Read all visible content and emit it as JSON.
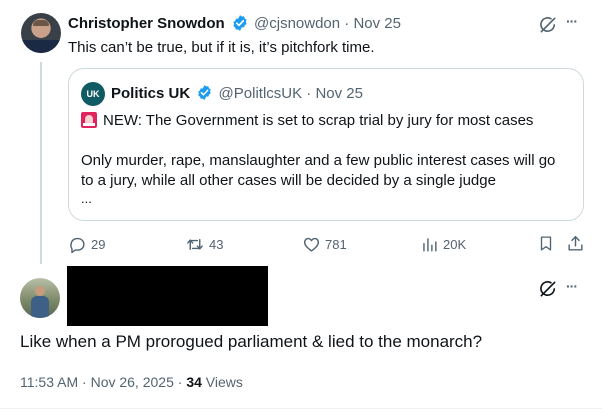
{
  "parent_tweet": {
    "author_name": "Christopher Snowdon",
    "handle": "@cjsnowdon",
    "separator": "·",
    "date": "Nov 25",
    "text": "This can’t be true, but if it is, it’s pitchfork time.",
    "more_label": "···"
  },
  "quote_tweet": {
    "avatar_text": "UK",
    "author_name": "Politics UK",
    "handle": "@PolitlcsUK",
    "separator": "·",
    "date": "Nov 25",
    "siren_emoji": "🚨",
    "headline": "NEW: The Government is set to scrap trial by jury for most cases",
    "body_line1": "Only murder, rape, manslaughter and a few public interest cases will go",
    "body_line2": "to a jury, while all other cases will be decided by a single judge",
    "ellipsis": "..."
  },
  "actions": {
    "replies": "29",
    "retweets": "43",
    "likes": "781",
    "views": "20K"
  },
  "reply_tweet": {
    "text": "Like when a PM prorogued parliament & lied to the monarch?",
    "time": "11:53 AM",
    "separator": "·",
    "date": "Nov 26, 2025",
    "separator2": "·",
    "views_count": "34",
    "views_label": "Views",
    "more_label": "···"
  },
  "colors": {
    "verified": "#1d9bf0",
    "muted": "#536471",
    "redaction": "#000000",
    "politics_avatar": "#0f5a63"
  },
  "icons": [
    "verified-badge-icon",
    "grok-icon",
    "reply-icon",
    "retweet-icon",
    "like-icon",
    "views-icon",
    "bookmark-icon",
    "share-icon",
    "siren-icon"
  ]
}
